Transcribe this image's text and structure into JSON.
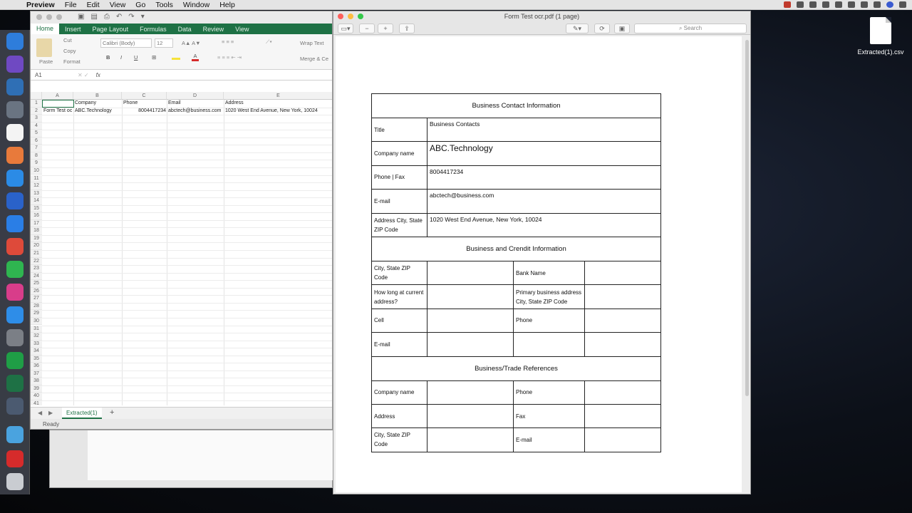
{
  "menubar": {
    "app": "Preview",
    "items": [
      "File",
      "Edit",
      "View",
      "Go",
      "Tools",
      "Window",
      "Help"
    ]
  },
  "desktop": {
    "file_label": "Extracted(1).csv"
  },
  "excel": {
    "tabs": [
      "Home",
      "Insert",
      "Page Layout",
      "Formulas",
      "Data",
      "Review",
      "View"
    ],
    "clipboard": {
      "paste": "Paste",
      "cut": "Cut",
      "copy": "Copy",
      "format": "Format"
    },
    "font_name": "Calibri (Body)",
    "font_size": "12",
    "wrap_text": "Wrap Text",
    "merge": "Merge & Ce",
    "name_box": "A1",
    "fx": "fx",
    "columns": [
      "A",
      "B",
      "C",
      "D",
      "E"
    ],
    "rows": [
      [
        "",
        "Company",
        "Phone",
        "Email",
        "Address"
      ],
      [
        "Form Test oc",
        "ABC.Technology",
        "8004417234",
        "abctech@business.com",
        "1020 West End Avenue, New York, 10024"
      ]
    ],
    "row_numbers": [
      "1",
      "2",
      "3",
      "4",
      "5",
      "6",
      "7",
      "8",
      "9",
      "10",
      "11",
      "12",
      "13",
      "14",
      "15",
      "16",
      "17",
      "18",
      "19",
      "20",
      "21",
      "22",
      "23",
      "24",
      "25",
      "26",
      "27",
      "28",
      "29",
      "30",
      "31",
      "32",
      "33",
      "34",
      "35",
      "36",
      "37",
      "38",
      "39",
      "40",
      "41"
    ],
    "sheet_tab": "Extracted(1)",
    "add_sheet": "+",
    "status": "Ready"
  },
  "preview": {
    "title": "Form Test ocr.pdf (1 page)",
    "search_placeholder": "Search",
    "form": {
      "section1": "Business Contact Information",
      "title_label": "Title",
      "title_value": "Business Contacts",
      "company_label": "Company name",
      "company_value": "ABC.Technology",
      "phone_label": "Phone | Fax",
      "phone_value": "8004417234",
      "email_label": "E-mail",
      "email_value": "abctech@business.com",
      "address_label": "Address City, State ZIP Code",
      "address_value": "1020 West End Avenue, New York, 10024",
      "section2": "Business and Crendit Information",
      "city_label": "City, State ZIP Code",
      "bank_label": "Bank Name",
      "howlong_label": "How long at current address?",
      "primary_label": "Primary business address City, State ZIP Code",
      "cell_label": "Cell",
      "phone2_label": "Phone",
      "email2_label": "E-mail",
      "section3": "Business/Trade References",
      "ref_company_label": "Company name",
      "ref_phone_label": "Phone",
      "ref_address_label": "Address",
      "ref_fax_label": "Fax",
      "ref_city_label": "City, State ZIP Code",
      "ref_email_label": "E-mail"
    }
  }
}
